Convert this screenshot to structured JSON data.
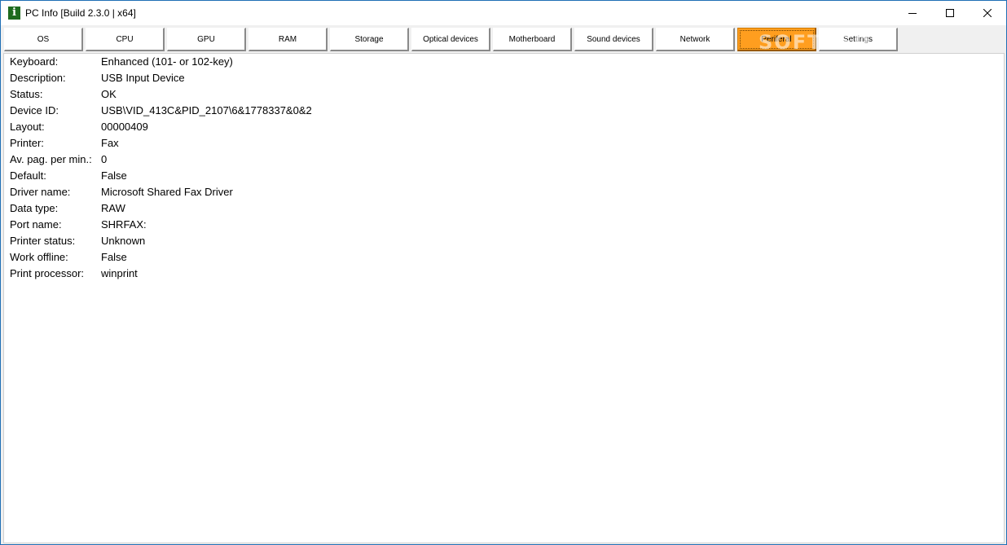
{
  "window": {
    "title": "PC Info [Build 2.3.0 | x64]",
    "app_icon_glyph": "i",
    "controls": [
      "minimize-icon",
      "maximize-icon",
      "close-icon"
    ]
  },
  "tabs": [
    {
      "label": "OS"
    },
    {
      "label": "CPU"
    },
    {
      "label": "GPU"
    },
    {
      "label": "RAM"
    },
    {
      "label": "Storage"
    },
    {
      "label": "Optical devices"
    },
    {
      "label": "Motherboard"
    },
    {
      "label": "Sound devices"
    },
    {
      "label": "Network"
    },
    {
      "label": "Periferal",
      "active": true
    },
    {
      "label": "Settings"
    }
  ],
  "watermark": "SOFTPEDIA",
  "properties": [
    {
      "key": "Keyboard:",
      "value": "Enhanced (101- or 102-key)"
    },
    {
      "key": "Description:",
      "value": "USB Input Device"
    },
    {
      "key": "Status:",
      "value": "OK"
    },
    {
      "key": "Device ID:",
      "value": "USB\\VID_413C&PID_2107\\6&1778337&0&2"
    },
    {
      "key": "Layout:",
      "value": "00000409"
    },
    {
      "key": "Printer:",
      "value": "Fax"
    },
    {
      "key": "Av. pag. per min.:",
      "value": "0"
    },
    {
      "key": "Default:",
      "value": "False"
    },
    {
      "key": "Driver name:",
      "value": "Microsoft Shared Fax Driver"
    },
    {
      "key": "Data type:",
      "value": "RAW"
    },
    {
      "key": "Port name:",
      "value": "SHRFAX:"
    },
    {
      "key": "Printer status:",
      "value": "Unknown"
    },
    {
      "key": "Work offline:",
      "value": "False"
    },
    {
      "key": "Print processor:",
      "value": "winprint"
    }
  ],
  "colors": {
    "active_tab": "#ff9e1f",
    "window_border": "#1f6fb5",
    "app_icon": "#1e6b1e"
  }
}
